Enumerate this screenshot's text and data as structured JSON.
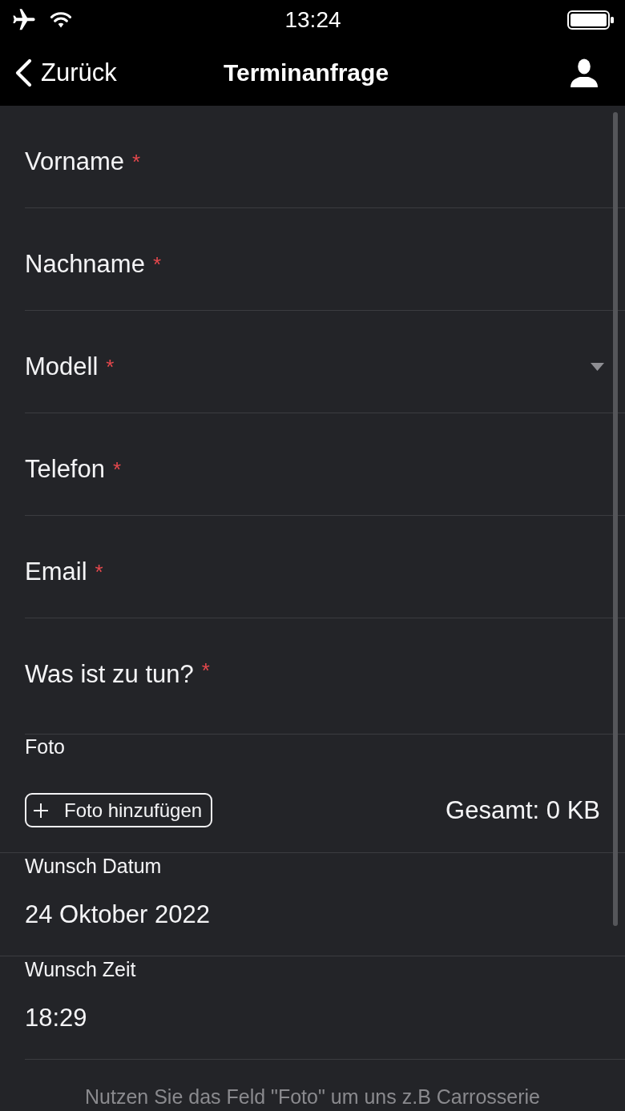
{
  "status_bar": {
    "time": "13:24"
  },
  "nav_bar": {
    "back": "Zurück",
    "title": "Terminanfrage"
  },
  "form": {
    "required_mark": "*",
    "fields": [
      {
        "kind": "text",
        "label": "Vorname",
        "required": true
      },
      {
        "kind": "text",
        "label": "Nachname",
        "required": true
      },
      {
        "kind": "select",
        "label": "Modell",
        "required": true
      },
      {
        "kind": "text",
        "label": "Telefon",
        "required": true
      },
      {
        "kind": "text",
        "label": "Email",
        "required": true
      },
      {
        "kind": "textarea",
        "label": "Was ist zu tun?",
        "required": true
      }
    ]
  },
  "photo": {
    "label": "Foto",
    "button": "Foto hinzufügen",
    "total": "Gesamt: 0 KB"
  },
  "pickers": [
    {
      "label": "Wunsch Datum",
      "value": "24 Oktober 2022"
    },
    {
      "label": "Wunsch Zeit",
      "value": "18:29"
    }
  ],
  "note": "Nutzen Sie das Feld \"Foto\" um uns z.B Carrosserie"
}
